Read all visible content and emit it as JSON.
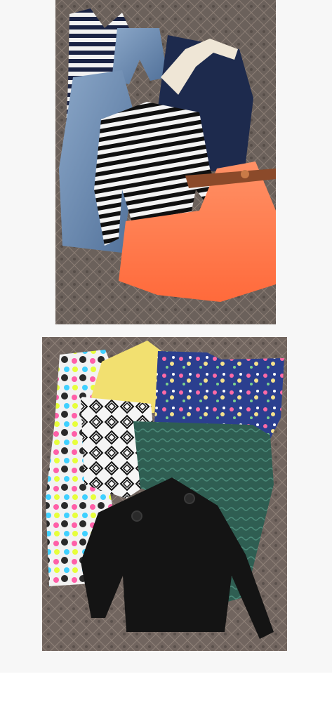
{
  "gallery": {
    "photos": [
      {
        "name": "clothes-photo-1",
        "items": [
          "striped-tank-top",
          "denim-shorts",
          "navy-cream-dress",
          "denim-romper",
          "striped-cardigan",
          "neon-coral-skirt",
          "brown-belt"
        ],
        "colors": {
          "carpet": "#6b615b",
          "navy": "#1d2a4d",
          "denim": "#6f8fb8",
          "coral": "#ff7a4a",
          "cream": "#efe6d6"
        }
      },
      {
        "name": "clothes-photo-2",
        "items": [
          "geometric-print-dress",
          "yellow-top",
          "floral-blue-blouse",
          "aztec-print-top",
          "green-knit-top",
          "black-knit-sweater"
        ],
        "colors": {
          "carpet": "#71655f",
          "yellow": "#f2e070",
          "blue": "#2b3f8f",
          "green": "#2f5e52",
          "black": "#141414"
        }
      }
    ]
  }
}
